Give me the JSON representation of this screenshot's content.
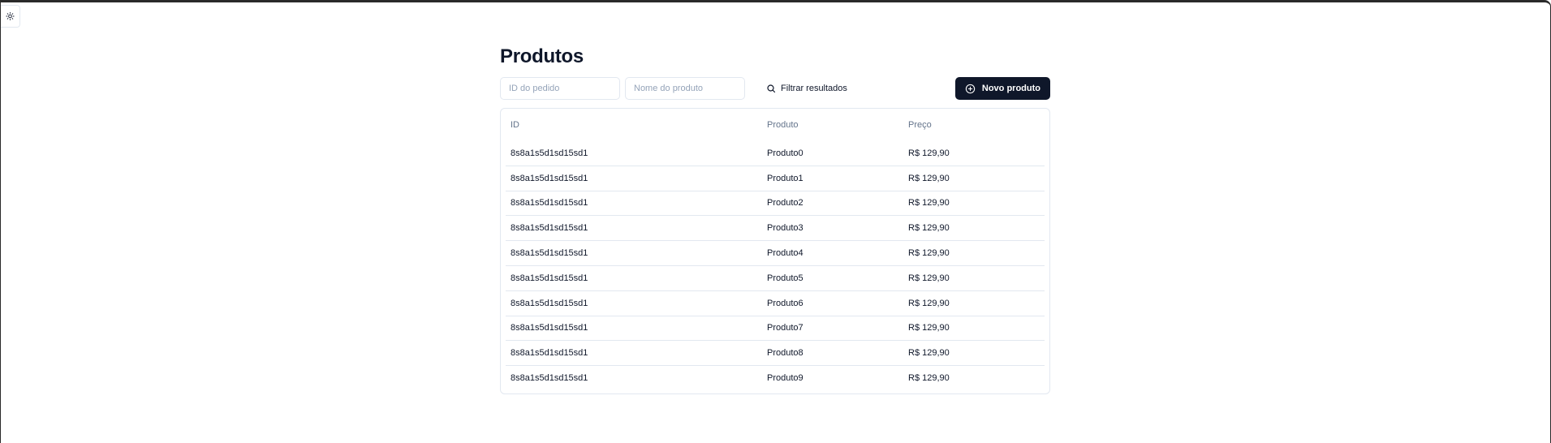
{
  "page": {
    "title": "Produtos"
  },
  "filters": {
    "order_id_placeholder": "ID do pedido",
    "product_name_placeholder": "Nome do produto",
    "filter_label": "Filtrar resultados"
  },
  "actions": {
    "new_product_label": "Novo produto"
  },
  "table": {
    "headers": {
      "id": "ID",
      "product": "Produto",
      "price": "Preço"
    },
    "rows": [
      {
        "id": "8s8a1s5d1sd15sd1",
        "product": "Produto0",
        "price": "R$ 129,90"
      },
      {
        "id": "8s8a1s5d1sd15sd1",
        "product": "Produto1",
        "price": "R$ 129,90"
      },
      {
        "id": "8s8a1s5d1sd15sd1",
        "product": "Produto2",
        "price": "R$ 129,90"
      },
      {
        "id": "8s8a1s5d1sd15sd1",
        "product": "Produto3",
        "price": "R$ 129,90"
      },
      {
        "id": "8s8a1s5d1sd15sd1",
        "product": "Produto4",
        "price": "R$ 129,90"
      },
      {
        "id": "8s8a1s5d1sd15sd1",
        "product": "Produto5",
        "price": "R$ 129,90"
      },
      {
        "id": "8s8a1s5d1sd15sd1",
        "product": "Produto6",
        "price": "R$ 129,90"
      },
      {
        "id": "8s8a1s5d1sd15sd1",
        "product": "Produto7",
        "price": "R$ 129,90"
      },
      {
        "id": "8s8a1s5d1sd15sd1",
        "product": "Produto8",
        "price": "R$ 129,90"
      },
      {
        "id": "8s8a1s5d1sd15sd1",
        "product": "Produto9",
        "price": "R$ 129,90"
      }
    ]
  },
  "icons": {
    "theme_toggle": "sun-icon",
    "filter": "search-icon",
    "new_product": "plus-circle-icon"
  },
  "colors": {
    "primary_button": "#0f172a",
    "border": "#e2e8f0",
    "muted_text": "#64748b"
  }
}
